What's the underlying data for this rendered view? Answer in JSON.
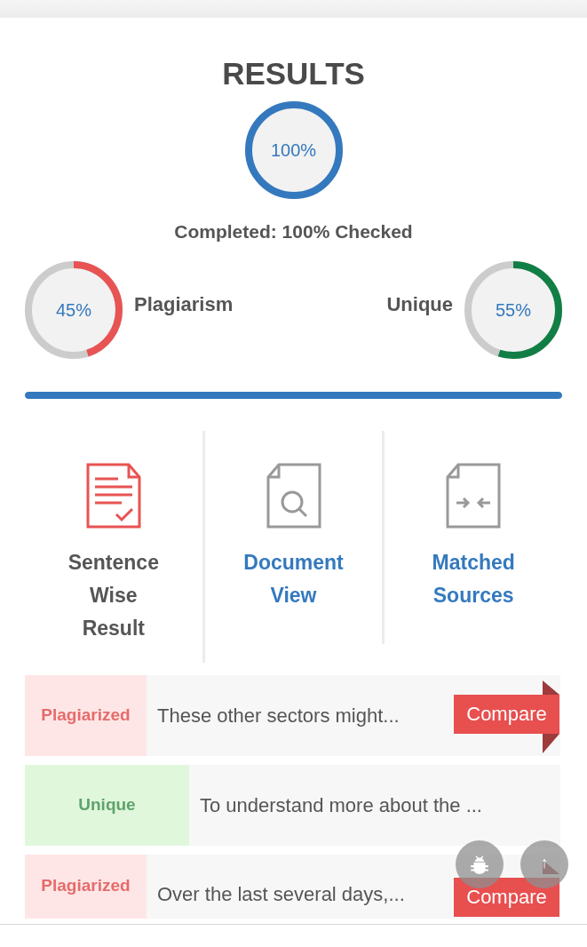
{
  "title": "RESULTS",
  "progress": {
    "value": "100%",
    "level": 1
  },
  "status": "Completed: 100% Checked",
  "bar": {
    "level": 1
  },
  "scores": [
    {
      "kind": "plagiarism",
      "label": "Plagiarism",
      "value": "45%",
      "level": 0.45,
      "color": "#e85353"
    },
    {
      "kind": "unique",
      "label": "Unique",
      "value": "55%",
      "level": 0.55,
      "color": "#117f45"
    }
  ],
  "tabs": [
    {
      "kind": "sentence",
      "label": "Sentence Wise Result",
      "selected": true
    },
    {
      "kind": "document",
      "label": "Document View",
      "selected": false
    },
    {
      "kind": "sources",
      "label": "Matched Sources",
      "selected": false
    }
  ],
  "rows": [
    {
      "kind": "plagiarized",
      "label": "Plagiarized",
      "text": "These other sectors might...",
      "button": "Compare"
    },
    {
      "kind": "unique",
      "label": "Unique",
      "text": "To understand more about the ..."
    },
    {
      "kind": "plagiarized",
      "label": "Plagiarized",
      "text": "Over the last several days,...",
      "button": "Compare"
    }
  ],
  "scroll_top_button": "↑"
}
